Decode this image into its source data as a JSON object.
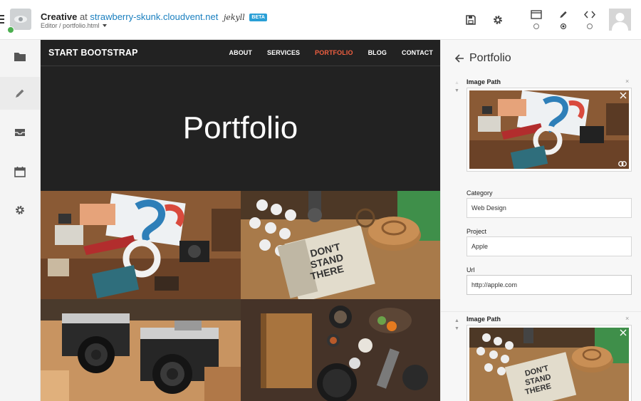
{
  "header": {
    "site_name": "Creative",
    "at": "at",
    "host": "strawberry-skunk.cloudvent.net",
    "ssg_logo": "jekyll",
    "badge": "BETA",
    "breadcrumb": "Editor / portfolio.html"
  },
  "toolbar": {
    "save_icon": "save-icon",
    "settings_icon": "gear-icon",
    "modes": [
      {
        "icon": "window-icon",
        "selected": false
      },
      {
        "icon": "pencil-icon",
        "selected": true
      },
      {
        "icon": "code-icon",
        "selected": false
      }
    ]
  },
  "rail": [
    "folder-icon",
    "pencil-icon",
    "inbox-icon",
    "calendar-icon",
    "gear-icon"
  ],
  "preview": {
    "brand": "START BOOTSTRAP",
    "nav": [
      "ABOUT",
      "SERVICES",
      "PORTFOLIO",
      "BLOG",
      "CONTACT"
    ],
    "active_nav": "PORTFOLIO",
    "hero_title": "Portfolio",
    "accent": "#f05f40"
  },
  "panel": {
    "title": "Portfolio",
    "image_path_label": "Image Path",
    "category_label": "Category",
    "category_value": "Web Design",
    "project_label": "Project",
    "project_value": "Apple",
    "url_label": "Url",
    "url_value": "http://apple.com",
    "image_path_label_2": "Image Path",
    "close_glyph": "×",
    "up_glyph": "▲",
    "down_glyph": "▼"
  }
}
